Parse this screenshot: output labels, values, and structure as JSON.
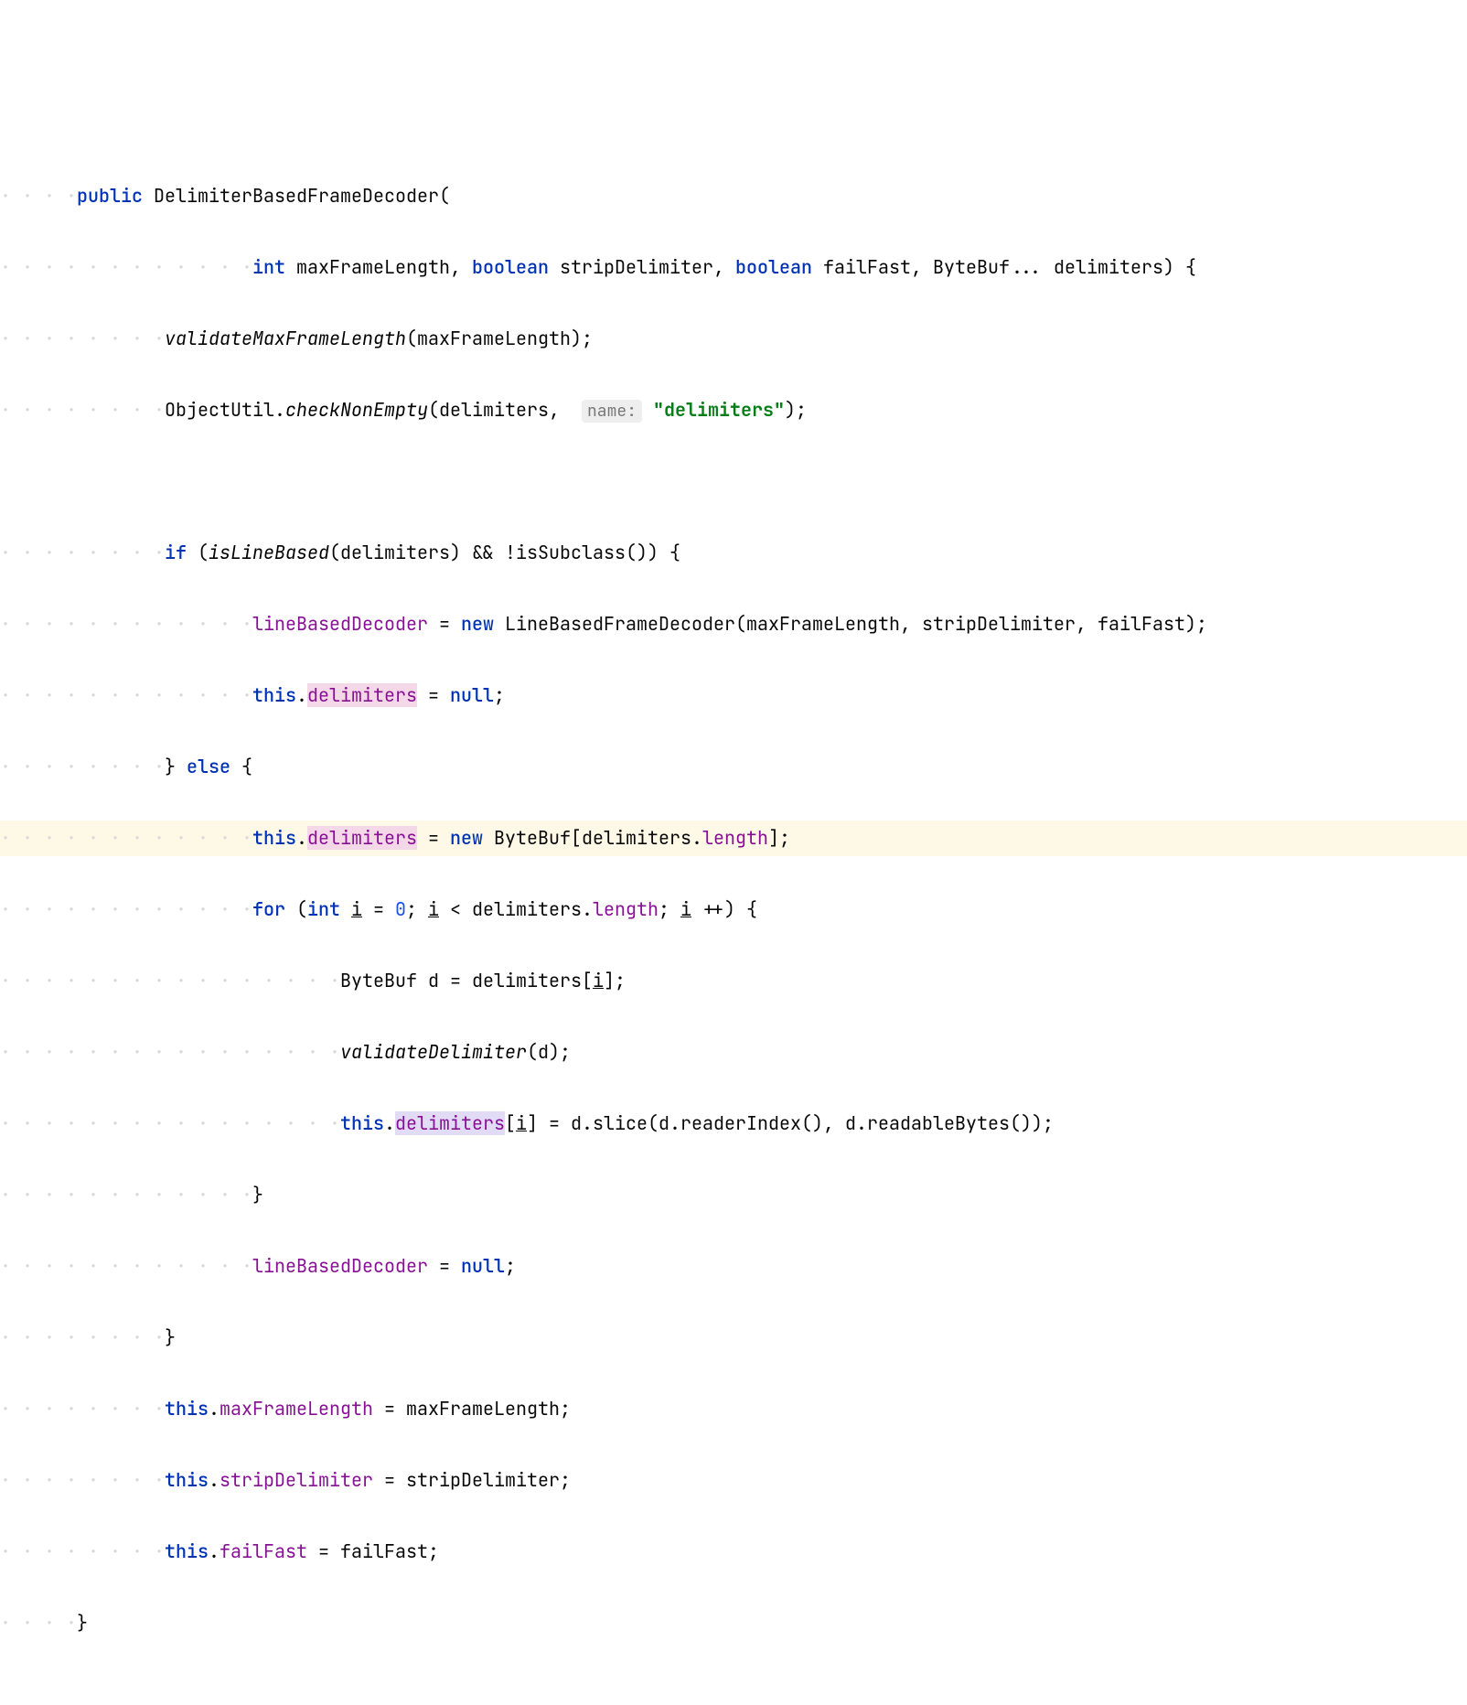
{
  "code": {
    "l1_dots": "· · · ·",
    "l1_kw_public": "public",
    "l1_sp1": " ",
    "l1_method": "DelimiterBasedFrameDecoder",
    "l1_paren": "(",
    "l2_dots": "· · · · · · · · · · · ·",
    "l2_kw_int": "int",
    "l2_sp1": " ",
    "l2_p1": "maxFrameLength,",
    "l2_sp2": " ",
    "l2_kw_bool1": "boolean",
    "l2_sp3": " ",
    "l2_p2": "stripDelimiter,",
    "l2_sp4": " ",
    "l2_kw_bool2": "boolean",
    "l2_sp5": " ",
    "l2_p3": "failFast,",
    "l2_sp6": " ",
    "l2_p4": "ByteBuf...",
    "l2_sp7": " ",
    "l2_p5": "delimiters)",
    "l2_sp8": " ",
    "l2_brace": "{",
    "l3_dots": "· · · · · · · ·",
    "l3_call": "validateMaxFrameLength",
    "l3_args": "(maxFrameLength);",
    "l4_dots": "· · · · · · · ·",
    "l4_obj": "ObjectUtil.",
    "l4_method": "checkNonEmpty",
    "l4_args1": "(delimiters,",
    "l4_sp1": " ",
    "l4_hint": "name:",
    "l4_sp2": " ",
    "l4_str": "\"delimiters\"",
    "l4_args2": ");",
    "l5_blank": "",
    "l6_dots": "· · · · · · · ·",
    "l6_kw_if": "if",
    "l6_sp1": " ",
    "l6_open": "(",
    "l6_call1": "isLineBased",
    "l6_args1": "(delimiters)",
    "l6_sp2": " ",
    "l6_and": "&&",
    "l6_sp3": " ",
    "l6_neg": "!isSubclass())",
    "l6_sp4": " ",
    "l6_brace": "{",
    "l7_dots": "· · · · · · · · · · · ·",
    "l7_field": "lineBasedDecoder",
    "l7_sp1": " ",
    "l7_eq": "=",
    "l7_sp2": " ",
    "l7_kw_new": "new",
    "l7_sp3": " ",
    "l7_ctor": "LineBasedFrameDecoder(maxFrameLength,",
    "l7_sp4": " ",
    "l7_a2": "stripDelimiter,",
    "l7_sp5": " ",
    "l7_a3": "failFast);",
    "l8_dots": "· · · · · · · · · · · ·",
    "l8_kw_this": "this",
    "l8_dot": ".",
    "l8_field": "delimiters",
    "l8_sp1": " ",
    "l8_eq": "=",
    "l8_sp2": " ",
    "l8_kw_null": "null",
    "l8_semi": ";",
    "l9_dots": "· · · · · · · ·",
    "l9_close": "}",
    "l9_sp1": " ",
    "l9_kw_else": "else",
    "l9_sp2": " ",
    "l9_open": "{",
    "l10_dots": "· · · · · · · · · · · ·",
    "l10_kw_this": "this",
    "l10_dot": ".",
    "l10_field": "delimiters",
    "l10_sp1": " ",
    "l10_eq": "=",
    "l10_sp2": " ",
    "l10_kw_new": "new",
    "l10_sp3": " ",
    "l10_type": "ByteBuf[delimiters.",
    "l10_len": "length",
    "l10_close": "];",
    "l11_dots": "· · · · · · · · · · · ·",
    "l11_kw_for": "for",
    "l11_sp1": " ",
    "l11_open": "(",
    "l11_kw_int": "int",
    "l11_sp2": " ",
    "l11_var": "i",
    "l11_sp3": " ",
    "l11_eq": "=",
    "l11_sp4": " ",
    "l11_num": "0",
    "l11_semi1": ";",
    "l11_sp5": " ",
    "l11_var2": "i",
    "l11_sp6": " ",
    "l11_lt": "<",
    "l11_sp7": " ",
    "l11_arr": "delimiters.",
    "l11_len": "length",
    "l11_semi2": ";",
    "l11_sp8": " ",
    "l11_var3": "i",
    "l11_sp9": " ",
    "l11_inc": "++)",
    "l11_sp10": " ",
    "l11_brace": "{",
    "l12_dots": "· · · · · · · · · · · · · · · ·",
    "l12_type": "ByteBuf",
    "l12_sp1": " ",
    "l12_var": "d",
    "l12_sp2": " ",
    "l12_eq": "=",
    "l12_sp3": " ",
    "l12_arr": "delimiters[",
    "l12_idx": "i",
    "l12_close": "];",
    "l13_dots": "· · · · · · · · · · · · · · · ·",
    "l13_call": "validateDelimiter",
    "l13_args": "(d);",
    "l14_dots": "· · · · · · · · · · · · · · · ·",
    "l14_kw_this": "this",
    "l14_dot": ".",
    "l14_field": "delimiters",
    "l14_open": "[",
    "l14_idx": "i",
    "l14_close": "]",
    "l14_sp1": " ",
    "l14_eq": "=",
    "l14_sp2": " ",
    "l14_expr": "d.slice(d.readerIndex(),",
    "l14_sp3": " ",
    "l14_expr2": "d.readableBytes());",
    "l15_dots": "· · · · · · · · · · · ·",
    "l15_close": "}",
    "l16_dots": "· · · · · · · · · · · ·",
    "l16_field": "lineBasedDecoder",
    "l16_sp1": " ",
    "l16_eq": "=",
    "l16_sp2": " ",
    "l16_kw_null": "null",
    "l16_semi": ";",
    "l17_dots": "· · · · · · · ·",
    "l17_close": "}",
    "l18_dots": "· · · · · · · ·",
    "l18_kw_this": "this",
    "l18_dot": ".",
    "l18_field": "maxFrameLength",
    "l18_sp1": " ",
    "l18_eq": "=",
    "l18_sp2": " ",
    "l18_val": "maxFrameLength;",
    "l19_dots": "· · · · · · · ·",
    "l19_kw_this": "this",
    "l19_dot": ".",
    "l19_field": "stripDelimiter",
    "l19_sp1": " ",
    "l19_eq": "=",
    "l19_sp2": " ",
    "l19_val": "stripDelimiter;",
    "l20_dots": "· · · · · · · ·",
    "l20_kw_this": "this",
    "l20_dot": ".",
    "l20_field": "failFast",
    "l20_sp1": " ",
    "l20_eq": "=",
    "l20_sp2": " ",
    "l20_val": "failFast;",
    "l21_dots": "· · · ·",
    "l21_close": "}"
  }
}
